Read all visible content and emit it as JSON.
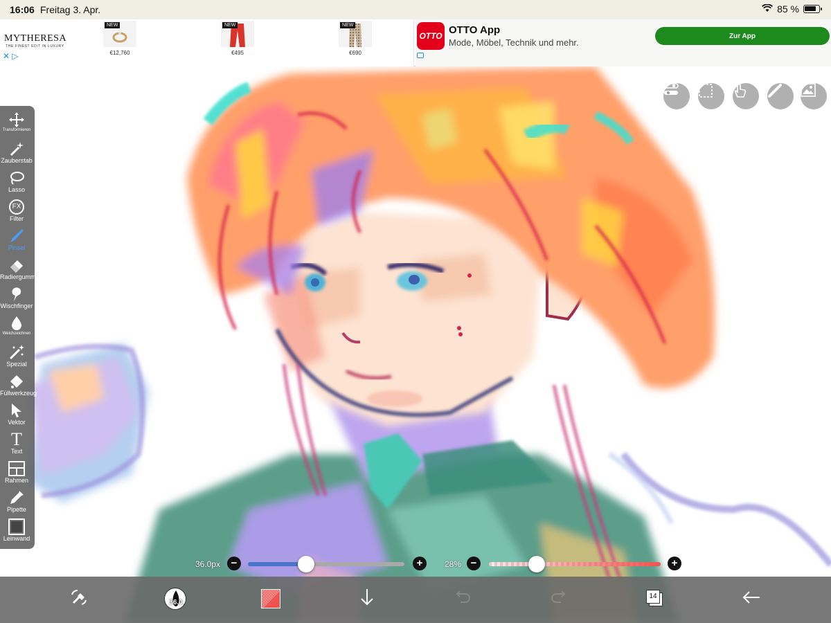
{
  "status_bar": {
    "time": "16:06",
    "date": "Freitag 3. Apr.",
    "battery": "85 %",
    "battery_level": 0.85
  },
  "ad": {
    "brand": "MYTHERESA",
    "brand_tagline": "THE FINEST EDIT IN LUXURY",
    "products": [
      {
        "badge": "NEW",
        "price": "€12,760"
      },
      {
        "badge": "NEW",
        "price": "€495"
      },
      {
        "badge": "NEW",
        "price": "€690"
      }
    ],
    "otto_logo": "OTTO",
    "otto_title": "OTTO App",
    "otto_subtitle": "Mode, Möbel, Technik und mehr.",
    "otto_button": "Zur App"
  },
  "top_tools": [
    "toggle-icon",
    "selection-icon",
    "hand-icon",
    "ruler-icon",
    "image-icon"
  ],
  "toolbar": {
    "items": [
      {
        "label": "Transformieren",
        "icon": "move-icon"
      },
      {
        "label": "Zauberstab",
        "icon": "magic-wand-icon"
      },
      {
        "label": "Lasso",
        "icon": "lasso-icon"
      },
      {
        "label": "Filter",
        "icon": "fx-icon",
        "glyph": "FX"
      },
      {
        "label": "Pinsel",
        "icon": "brush-icon",
        "active": true
      },
      {
        "label": "Radiergummi",
        "icon": "eraser-icon"
      },
      {
        "label": "Wischfinger",
        "icon": "smudge-icon"
      },
      {
        "label": "Weichzeichnen",
        "icon": "blur-icon"
      },
      {
        "label": "Spezial",
        "icon": "special-icon"
      },
      {
        "label": "Füllwerkzeug",
        "icon": "bucket-icon"
      },
      {
        "label": "Vektor",
        "icon": "vector-icon"
      },
      {
        "label": "Text",
        "icon": "text-icon",
        "glyph": "T"
      },
      {
        "label": "Rahmen",
        "icon": "frame-icon"
      },
      {
        "label": "Pipette",
        "icon": "eyedropper-icon"
      },
      {
        "label": "Leinwand",
        "icon": "canvas-icon"
      }
    ]
  },
  "sliders": {
    "size_label": "36.0px",
    "size_value": 0.37,
    "opacity_label": "28%",
    "opacity_value": 0.28,
    "minus": "−",
    "plus": "+"
  },
  "bottom_bar": {
    "brush_size_badge": "36.0",
    "layer_count": "14",
    "colors": {
      "brush_color": "#ef5450",
      "accent": "#4a9df6"
    }
  }
}
